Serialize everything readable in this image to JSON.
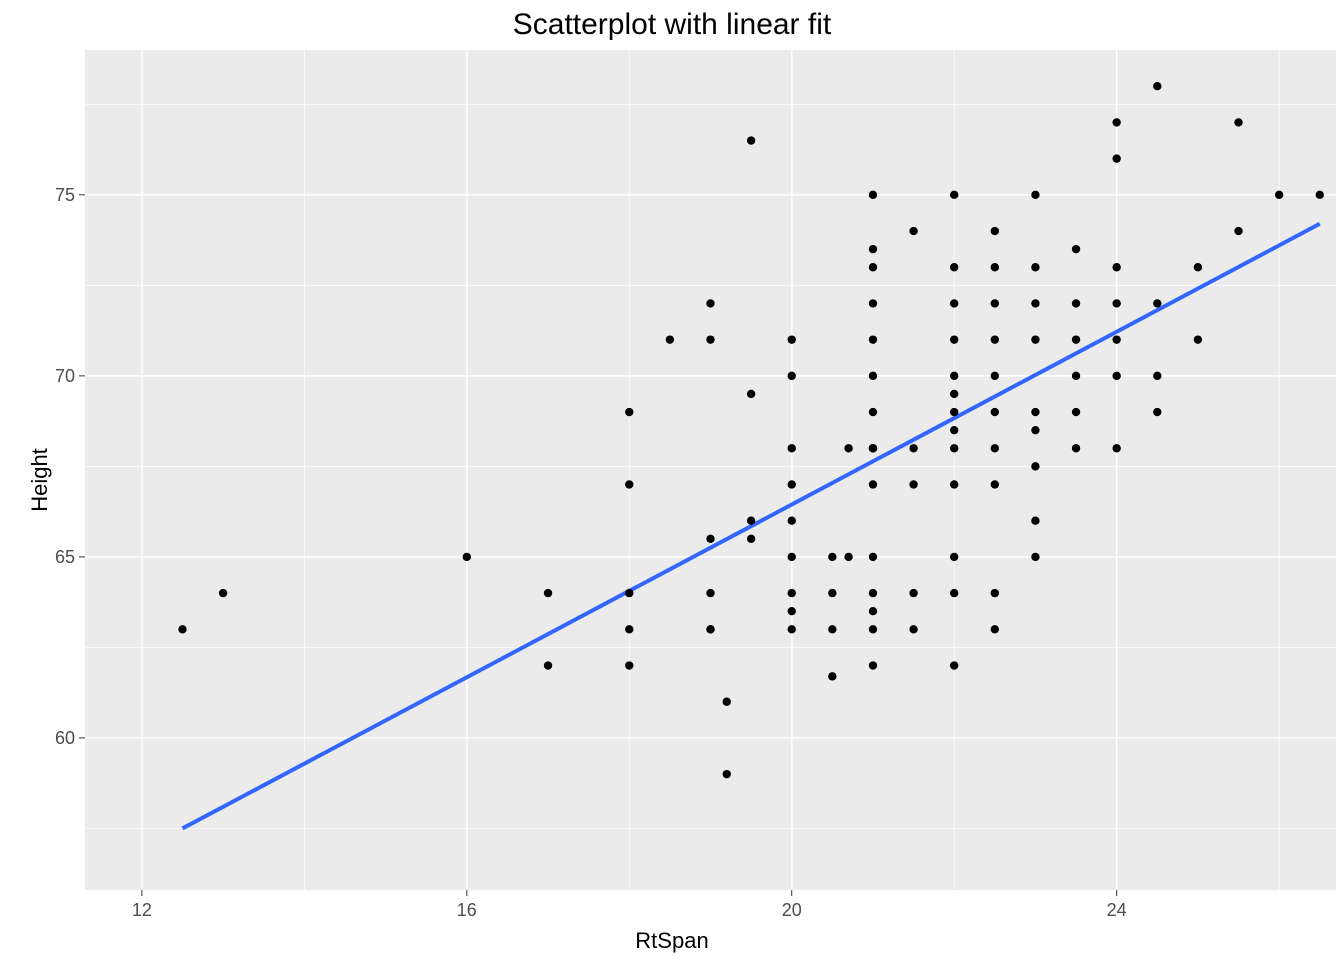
{
  "chart_data": {
    "type": "scatter",
    "title": "Scatterplot with linear fit",
    "xlabel": "RtSpan",
    "ylabel": "Height",
    "xlim": [
      11.3,
      26.7
    ],
    "ylim": [
      55.8,
      79.0
    ],
    "x_ticks": [
      12,
      16,
      20,
      24
    ],
    "y_ticks": [
      60,
      65,
      70,
      75
    ],
    "x_minor": [
      14,
      18,
      22,
      26
    ],
    "y_minor": [
      57.5,
      62.5,
      67.5,
      72.5,
      77.5
    ],
    "fit_line": {
      "x1": 12.5,
      "y1": 57.5,
      "x2": 26.5,
      "y2": 74.2
    },
    "points": [
      [
        12.5,
        63
      ],
      [
        13,
        64
      ],
      [
        16,
        65
      ],
      [
        17,
        62
      ],
      [
        17,
        64
      ],
      [
        18,
        62
      ],
      [
        18,
        63
      ],
      [
        18,
        64
      ],
      [
        18,
        67
      ],
      [
        18,
        69
      ],
      [
        18.5,
        71
      ],
      [
        19,
        63
      ],
      [
        19,
        63
      ],
      [
        19,
        64
      ],
      [
        19,
        65.5
      ],
      [
        19,
        71
      ],
      [
        19,
        72
      ],
      [
        19.2,
        59
      ],
      [
        19.2,
        61
      ],
      [
        19.5,
        65.5
      ],
      [
        19.5,
        66
      ],
      [
        19.5,
        69.5
      ],
      [
        19.5,
        76.5
      ],
      [
        20,
        63
      ],
      [
        20,
        63.5
      ],
      [
        20,
        64
      ],
      [
        20,
        65
      ],
      [
        20,
        66
      ],
      [
        20,
        67
      ],
      [
        20,
        68
      ],
      [
        20,
        70
      ],
      [
        20,
        71
      ],
      [
        20.5,
        61.7
      ],
      [
        20.5,
        63
      ],
      [
        20.5,
        64
      ],
      [
        20.5,
        65
      ],
      [
        20.7,
        65
      ],
      [
        20.7,
        68
      ],
      [
        21,
        62
      ],
      [
        21,
        63
      ],
      [
        21,
        63.5
      ],
      [
        21,
        64
      ],
      [
        21,
        65
      ],
      [
        21,
        67
      ],
      [
        21,
        68
      ],
      [
        21,
        68
      ],
      [
        21,
        68
      ],
      [
        21,
        69
      ],
      [
        21,
        70
      ],
      [
        21,
        71
      ],
      [
        21,
        72
      ],
      [
        21,
        73
      ],
      [
        21,
        73.5
      ],
      [
        21,
        75
      ],
      [
        21.5,
        63
      ],
      [
        21.5,
        64
      ],
      [
        21.5,
        67
      ],
      [
        21.5,
        68
      ],
      [
        21.5,
        74
      ],
      [
        22,
        62
      ],
      [
        22,
        64
      ],
      [
        22,
        65
      ],
      [
        22,
        67
      ],
      [
        22,
        68
      ],
      [
        22,
        68.5
      ],
      [
        22,
        69
      ],
      [
        22,
        69.5
      ],
      [
        22,
        70
      ],
      [
        22,
        71
      ],
      [
        22,
        72
      ],
      [
        22,
        73
      ],
      [
        22,
        75
      ],
      [
        22.5,
        63
      ],
      [
        22.5,
        64
      ],
      [
        22.5,
        67
      ],
      [
        22.5,
        68
      ],
      [
        22.5,
        69
      ],
      [
        22.5,
        70
      ],
      [
        22.5,
        71
      ],
      [
        22.5,
        72
      ],
      [
        22.5,
        73
      ],
      [
        22.5,
        74
      ],
      [
        23,
        65
      ],
      [
        23,
        66
      ],
      [
        23,
        67.5
      ],
      [
        23,
        68.5
      ],
      [
        23,
        69
      ],
      [
        23,
        71
      ],
      [
        23,
        72
      ],
      [
        23,
        73
      ],
      [
        23,
        75
      ],
      [
        23.5,
        68
      ],
      [
        23.5,
        69
      ],
      [
        23.5,
        70
      ],
      [
        23.5,
        71
      ],
      [
        23.5,
        72
      ],
      [
        23.5,
        73.5
      ],
      [
        24,
        68
      ],
      [
        24,
        70
      ],
      [
        24,
        71
      ],
      [
        24,
        72
      ],
      [
        24,
        73
      ],
      [
        24,
        76
      ],
      [
        24,
        77
      ],
      [
        24.5,
        69
      ],
      [
        24.5,
        70
      ],
      [
        24.5,
        72
      ],
      [
        24.5,
        78
      ],
      [
        25,
        71
      ],
      [
        25,
        73
      ],
      [
        25.5,
        74
      ],
      [
        25.5,
        77
      ],
      [
        26,
        75
      ],
      [
        26.5,
        75
      ]
    ]
  }
}
